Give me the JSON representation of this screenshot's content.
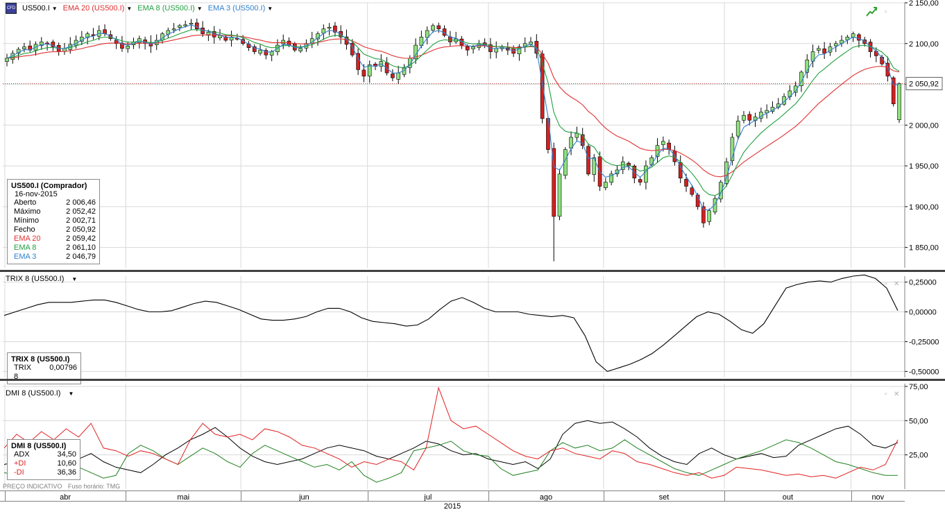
{
  "main_pane": {
    "symbol_icon": "cfd-symbol-icon",
    "symbol": "US500.I",
    "ema20_label": "EMA 20 (US500.I)",
    "ema8_label": "EMA 8 (US500.I)",
    "ema3_label": "EMA 3 (US500.I)",
    "trend_icon": "trend-arrow-icon",
    "current_price": "2 050,92",
    "legend": {
      "title": "US500.I (Comprador)",
      "date": "16-nov-2015",
      "rows": [
        {
          "label": "Aberto",
          "value": "2 006,46"
        },
        {
          "label": "Máximo",
          "value": "2 052,42"
        },
        {
          "label": "Mínimo",
          "value": "2 002,71"
        },
        {
          "label": "Fecho",
          "value": "2 050,92"
        },
        {
          "label": "EMA 20",
          "value": "2 059,42"
        },
        {
          "label": "EMA 8",
          "value": "2 061,10"
        },
        {
          "label": "EMA 3",
          "value": "2 046,79"
        }
      ]
    }
  },
  "trix_pane": {
    "label": "TRIX 8 (US500.I)",
    "legend": {
      "title": "TRIX 8 (US500.I)",
      "rows": [
        {
          "label": "TRIX 8",
          "value": "0,00796"
        }
      ]
    }
  },
  "dmi_pane": {
    "label": "DMI 8 (US500.I)",
    "legend": {
      "title": "DMI 8 (US500.I)",
      "rows": [
        {
          "label": "ADX",
          "value": "34,50"
        },
        {
          "label": "+DI",
          "value": "10,60"
        },
        {
          "label": "-DI",
          "value": "36,36"
        }
      ]
    }
  },
  "footer": {
    "price_type": "PREÇO INDICATIVO",
    "timezone": "Fuso horário: TMG"
  },
  "x_axis": {
    "months": [
      "abr",
      "mai",
      "jun",
      "jul",
      "ago",
      "set",
      "out",
      "nov"
    ],
    "year": "2015"
  },
  "colors": {
    "up": "#90e080",
    "down": "#d42020",
    "ema20": "#e03030",
    "ema8": "#20a040",
    "ema3": "#3080d0",
    "adx": "#000000",
    "plus_di": "#208020",
    "minus_di": "#e02020",
    "grid": "#d8d8d8"
  },
  "chart_data": [
    {
      "type": "candlestick",
      "ylim": [
        1825,
        2150
      ],
      "y_ticks": [
        "2 150,00",
        "2 100,00",
        "2 050,00",
        "2 000,00",
        "1 950,00",
        "1 900,00",
        "1 850,00"
      ],
      "tick_values": [
        2150,
        2100,
        2050,
        2000,
        1950,
        1900,
        1850
      ],
      "month_start_index": [
        0,
        21,
        41,
        63,
        84,
        104,
        125,
        147
      ],
      "last_close": 2050.92,
      "closes": [
        2082,
        2088,
        2093,
        2096,
        2092,
        2099,
        2102,
        2100,
        2096,
        2090,
        2094,
        2099,
        2104,
        2108,
        2112,
        2110,
        2116,
        2112,
        2106,
        2100,
        2094,
        2097,
        2102,
        2106,
        2100,
        2097,
        2104,
        2112,
        2116,
        2118,
        2122,
        2123,
        2125,
        2118,
        2112,
        2114,
        2108,
        2110,
        2104,
        2108,
        2106,
        2100,
        2095,
        2090,
        2092,
        2086,
        2090,
        2098,
        2104,
        2098,
        2092,
        2094,
        2100,
        2106,
        2112,
        2118,
        2120,
        2114,
        2108,
        2099,
        2086,
        2068,
        2060,
        2074,
        2072,
        2078,
        2064,
        2058,
        2064,
        2070,
        2082,
        2098,
        2108,
        2116,
        2122,
        2118,
        2110,
        2102,
        2106,
        2098,
        2092,
        2096,
        2100,
        2098,
        2090,
        2094,
        2096,
        2092,
        2088,
        2096,
        2100,
        2102,
        2088,
        2008,
        1970,
        1888,
        1940,
        1970,
        1985,
        1990,
        1975,
        1940,
        1960,
        1925,
        1930,
        1940,
        1945,
        1955,
        1950,
        1935,
        1930,
        1950,
        1960,
        1975,
        1980,
        1970,
        1955,
        1935,
        1925,
        1915,
        1900,
        1880,
        1895,
        1910,
        1930,
        1955,
        1985,
        2005,
        2012,
        2006,
        2010,
        2016,
        2018,
        2022,
        2026,
        2035,
        2042,
        2048,
        2065,
        2080,
        2090,
        2094,
        2088,
        2096,
        2100,
        2104,
        2108,
        2112,
        2104,
        2100,
        2090,
        2085,
        2075,
        2060,
        2026,
        2051
      ]
    },
    {
      "type": "line",
      "name": "TRIX 8",
      "ylim": [
        -0.55,
        0.3
      ],
      "y_ticks": [
        "0,25000",
        "0,00000",
        "-0,25000",
        "-0,50000"
      ],
      "tick_values": [
        0.25,
        0,
        -0.25,
        -0.5
      ],
      "values": [
        -0.03,
        0.0,
        0.03,
        0.06,
        0.08,
        0.08,
        0.08,
        0.09,
        0.1,
        0.1,
        0.08,
        0.05,
        0.02,
        0.0,
        0.0,
        0.01,
        0.04,
        0.07,
        0.09,
        0.08,
        0.05,
        0.02,
        -0.02,
        -0.06,
        -0.07,
        -0.07,
        -0.06,
        -0.04,
        0.0,
        0.03,
        0.03,
        0.0,
        -0.05,
        -0.08,
        -0.09,
        -0.1,
        -0.12,
        -0.11,
        -0.06,
        0.02,
        0.09,
        0.12,
        0.08,
        0.03,
        0.0,
        0.0,
        0.0,
        -0.02,
        -0.03,
        -0.04,
        -0.03,
        -0.05,
        -0.2,
        -0.42,
        -0.5,
        -0.47,
        -0.44,
        -0.4,
        -0.35,
        -0.28,
        -0.2,
        -0.12,
        -0.04,
        0.0,
        -0.02,
        -0.08,
        -0.15,
        -0.18,
        -0.1,
        0.05,
        0.2,
        0.23,
        0.25,
        0.26,
        0.25,
        0.28,
        0.3,
        0.31,
        0.28,
        0.2,
        0.01
      ]
    },
    {
      "type": "line",
      "ylim": [
        0,
        77
      ],
      "y_ticks": [
        "75,00",
        "50,00",
        "25,00"
      ],
      "tick_values": [
        75,
        50,
        25
      ],
      "series": [
        {
          "name": "ADX",
          "values": [
            18,
            20,
            16,
            12,
            20,
            24,
            22,
            26,
            20,
            16,
            14,
            12,
            18,
            25,
            30,
            36,
            40,
            45,
            38,
            30,
            24,
            20,
            18,
            20,
            22,
            26,
            30,
            32,
            30,
            28,
            24,
            22,
            26,
            30,
            35,
            33,
            28,
            25,
            26,
            22,
            20,
            18,
            20,
            15,
            22,
            40,
            48,
            50,
            48,
            49,
            44,
            38,
            30,
            24,
            20,
            18,
            26,
            30,
            25,
            22,
            24,
            26,
            23,
            24,
            32,
            36,
            40,
            44,
            46,
            40,
            32,
            30,
            34
          ]
        },
        {
          "name": "+DI",
          "values": [
            12,
            10,
            18,
            24,
            28,
            22,
            16,
            12,
            8,
            10,
            26,
            32,
            28,
            22,
            18,
            24,
            30,
            26,
            20,
            16,
            26,
            32,
            28,
            24,
            20,
            16,
            18,
            14,
            20,
            10,
            5,
            8,
            12,
            28,
            30,
            32,
            35,
            28,
            25,
            24,
            15,
            10,
            12,
            14,
            28,
            34,
            30,
            32,
            28,
            30,
            36,
            30,
            25,
            20,
            15,
            12,
            10,
            14,
            18,
            22,
            25,
            28,
            32,
            36,
            34,
            30,
            25,
            20,
            18,
            15,
            12,
            10,
            10
          ]
        },
        {
          "name": "-DI",
          "values": [
            30,
            40,
            34,
            42,
            36,
            44,
            38,
            48,
            30,
            28,
            24,
            28,
            26,
            22,
            18,
            36,
            48,
            40,
            38,
            40,
            36,
            44,
            42,
            38,
            32,
            30,
            26,
            22,
            16,
            20,
            18,
            22,
            20,
            14,
            30,
            74,
            50,
            44,
            46,
            40,
            34,
            28,
            24,
            22,
            28,
            30,
            26,
            24,
            22,
            28,
            26,
            20,
            18,
            15,
            12,
            10,
            12,
            8,
            10,
            16,
            15,
            14,
            12,
            10,
            11,
            9,
            10,
            8,
            12,
            16,
            14,
            18,
            36
          ]
        }
      ]
    }
  ]
}
